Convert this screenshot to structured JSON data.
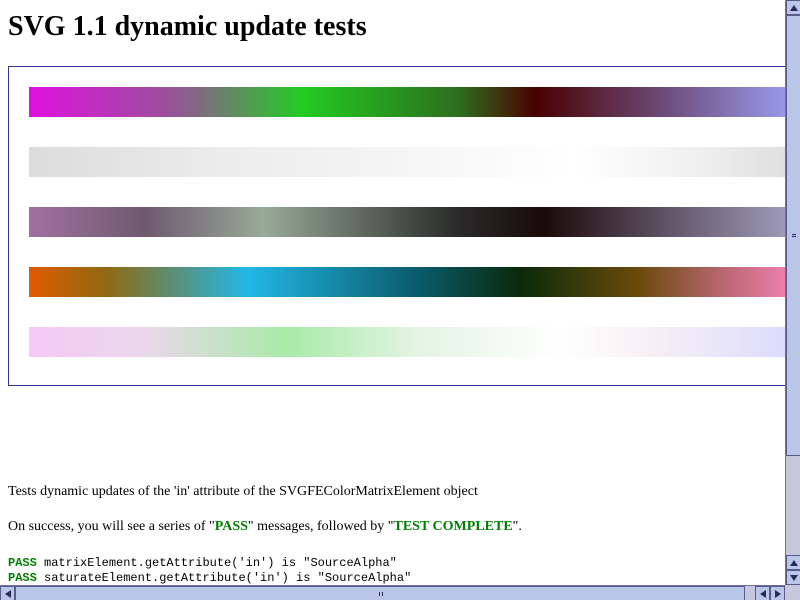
{
  "page": {
    "title": "SVG 1.1 dynamic update tests"
  },
  "gradients": [
    {
      "name": "gradient-bar-1",
      "stops": [
        "#e010e0",
        "#9a509a",
        "#22cc22",
        "#2e6e1e",
        "#4a0000",
        "#6e4e7e",
        "#a0a8ff"
      ],
      "offsets": [
        0,
        0.18,
        0.35,
        0.55,
        0.65,
        0.82,
        1
      ]
    },
    {
      "name": "gradient-bar-2",
      "stops": [
        "#dcdcdc",
        "#ececec",
        "#f6f6f6",
        "#ffffff",
        "#f0f0f0",
        "#dcdcdc"
      ],
      "offsets": [
        0,
        0.25,
        0.5,
        0.7,
        0.85,
        1
      ]
    },
    {
      "name": "gradient-bar-3",
      "stops": [
        "#a070a0",
        "#6e5a6e",
        "#98aa98",
        "#2a2a2a",
        "#1a0a0a",
        "#6e6278",
        "#a8a8c8"
      ],
      "offsets": [
        0,
        0.15,
        0.3,
        0.55,
        0.66,
        0.85,
        1
      ]
    },
    {
      "name": "gradient-bar-4",
      "stops": [
        "#e05a00",
        "#8e6a12",
        "#22b8e6",
        "#0a5a6a",
        "#0a2a0a",
        "#6a4a0a",
        "#c06a7a",
        "#ff88c0"
      ],
      "offsets": [
        0,
        0.1,
        0.28,
        0.5,
        0.63,
        0.78,
        0.9,
        1
      ]
    },
    {
      "name": "gradient-bar-5",
      "stops": [
        "#f6c8f6",
        "#ead8ea",
        "#a8eaa8",
        "#e4f4e4",
        "#ffffff",
        "#f6f0f4",
        "#d8d8ff"
      ],
      "offsets": [
        0,
        0.15,
        0.33,
        0.5,
        0.68,
        0.8,
        1
      ]
    }
  ],
  "description": "Tests dynamic updates of the 'in' attribute of the SVGFEColorMatrixElement object",
  "success_note": {
    "prefix": "On success, you will see a series of \"",
    "pass": "PASS",
    "middle": "\" messages, followed by \"",
    "complete": "TEST COMPLETE",
    "suffix": "\"."
  },
  "log": [
    {
      "status": "PASS",
      "text": " matrixElement.getAttribute('in') is \"SourceAlpha\""
    },
    {
      "status": "PASS",
      "text": " saturateElement.getAttribute('in') is \"SourceAlpha\""
    }
  ],
  "colors": {
    "pass": "#008000",
    "frame_border": "#333399"
  }
}
